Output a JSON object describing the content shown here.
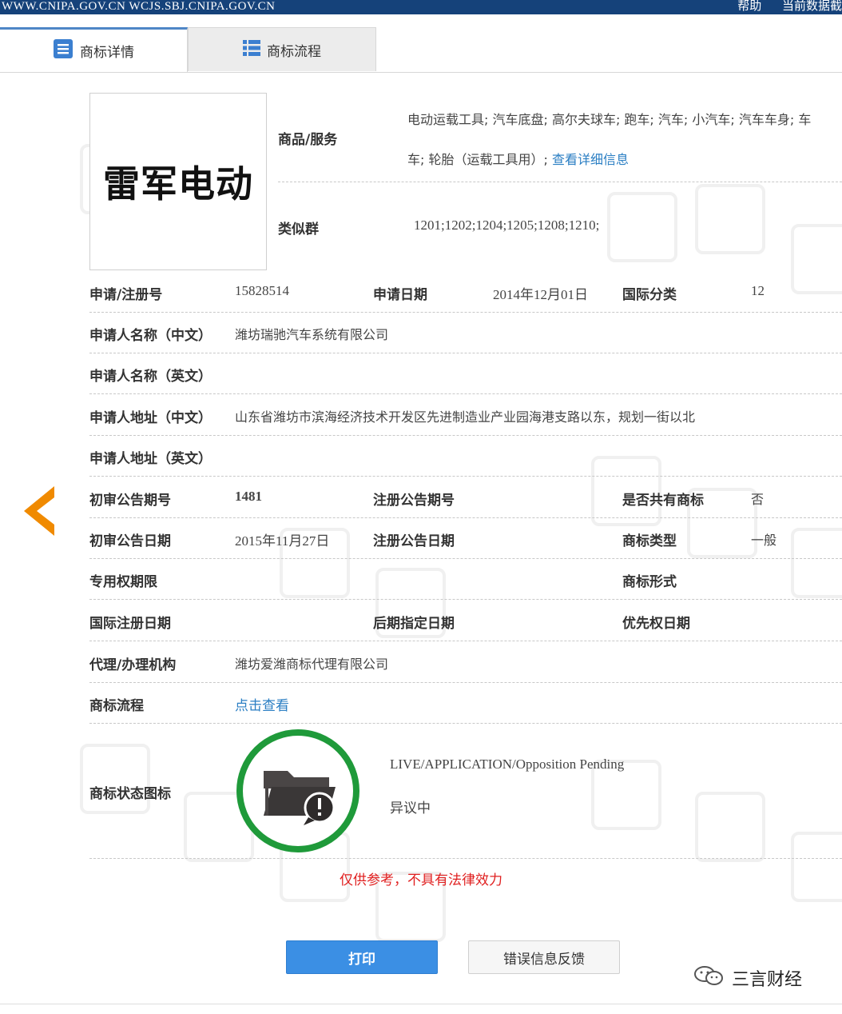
{
  "topbar": {
    "domains": "WWW.CNIPA.GOV.CN  WCJS.SBJ.CNIPA.GOV.CN",
    "help": "帮助",
    "current_data": "当前数据截"
  },
  "tabs": [
    {
      "label": "商标详情",
      "icon": "document-list-icon",
      "active": true
    },
    {
      "label": "商标流程",
      "icon": "list-icon",
      "active": false
    }
  ],
  "trademark": {
    "logo_text": "雷军电动"
  },
  "goods": {
    "label": "商品/服务",
    "line1": "电动运载工具; 汽车底盘; 高尔夫球车; 跑车; 汽车; 小汽车; 汽车车身; 车",
    "line2": "车; 轮胎（运载工具用）; ",
    "detail_link": "查看详细信息"
  },
  "similar_group": {
    "label": "类似群",
    "value": "1201;1202;1204;1205;1208;1210;"
  },
  "fields": {
    "reg_no": {
      "label": "申请/注册号",
      "value": "15828514"
    },
    "app_date": {
      "label": "申请日期",
      "value": "2014年12月01日"
    },
    "intl_class": {
      "label": "国际分类",
      "value": "12"
    },
    "applicant_cn": {
      "label": "申请人名称（中文）",
      "value": "潍坊瑞驰汽车系统有限公司"
    },
    "applicant_en": {
      "label": "申请人名称（英文）",
      "value": ""
    },
    "address_cn": {
      "label": "申请人地址（中文）",
      "value": "山东省潍坊市滨海经济技术开发区先进制造业产业园海港支路以东，规划一街以北"
    },
    "address_en": {
      "label": "申请人地址（英文）",
      "value": ""
    },
    "prelim_no": {
      "label": "初审公告期号",
      "value": "1481"
    },
    "reg_pub_no": {
      "label": "注册公告期号",
      "value": ""
    },
    "shared": {
      "label": "是否共有商标",
      "value": "否"
    },
    "prelim_date": {
      "label": "初审公告日期",
      "value": "2015年11月27日"
    },
    "reg_pub_date": {
      "label": "注册公告日期",
      "value": ""
    },
    "tm_type": {
      "label": "商标类型",
      "value": "一般"
    },
    "exclusive_period": {
      "label": "专用权期限",
      "value": ""
    },
    "tm_form": {
      "label": "商标形式",
      "value": ""
    },
    "intl_reg_date": {
      "label": "国际注册日期",
      "value": ""
    },
    "later_date": {
      "label": "后期指定日期",
      "value": ""
    },
    "priority_date": {
      "label": "优先权日期",
      "value": ""
    },
    "agent": {
      "label": "代理/办理机构",
      "value": "潍坊爱潍商标代理有限公司"
    },
    "process": {
      "label": "商标流程",
      "value": "点击查看"
    }
  },
  "status": {
    "label": "商标状态图标",
    "icon": "folder-alert-icon",
    "en": "LIVE/APPLICATION/Opposition Pending",
    "cn": "异议中",
    "ring_color": "#1f9a3a"
  },
  "notice": "仅供参考，不具有法律效力",
  "buttons": {
    "print": "打印",
    "feedback": "错误信息反馈"
  },
  "watermark_brand": "三言财经",
  "colors": {
    "accent_blue": "#3b8fe4",
    "link": "#2a7ec3",
    "nav_arrow": "#f08a00",
    "notice_red": "#e02020"
  }
}
